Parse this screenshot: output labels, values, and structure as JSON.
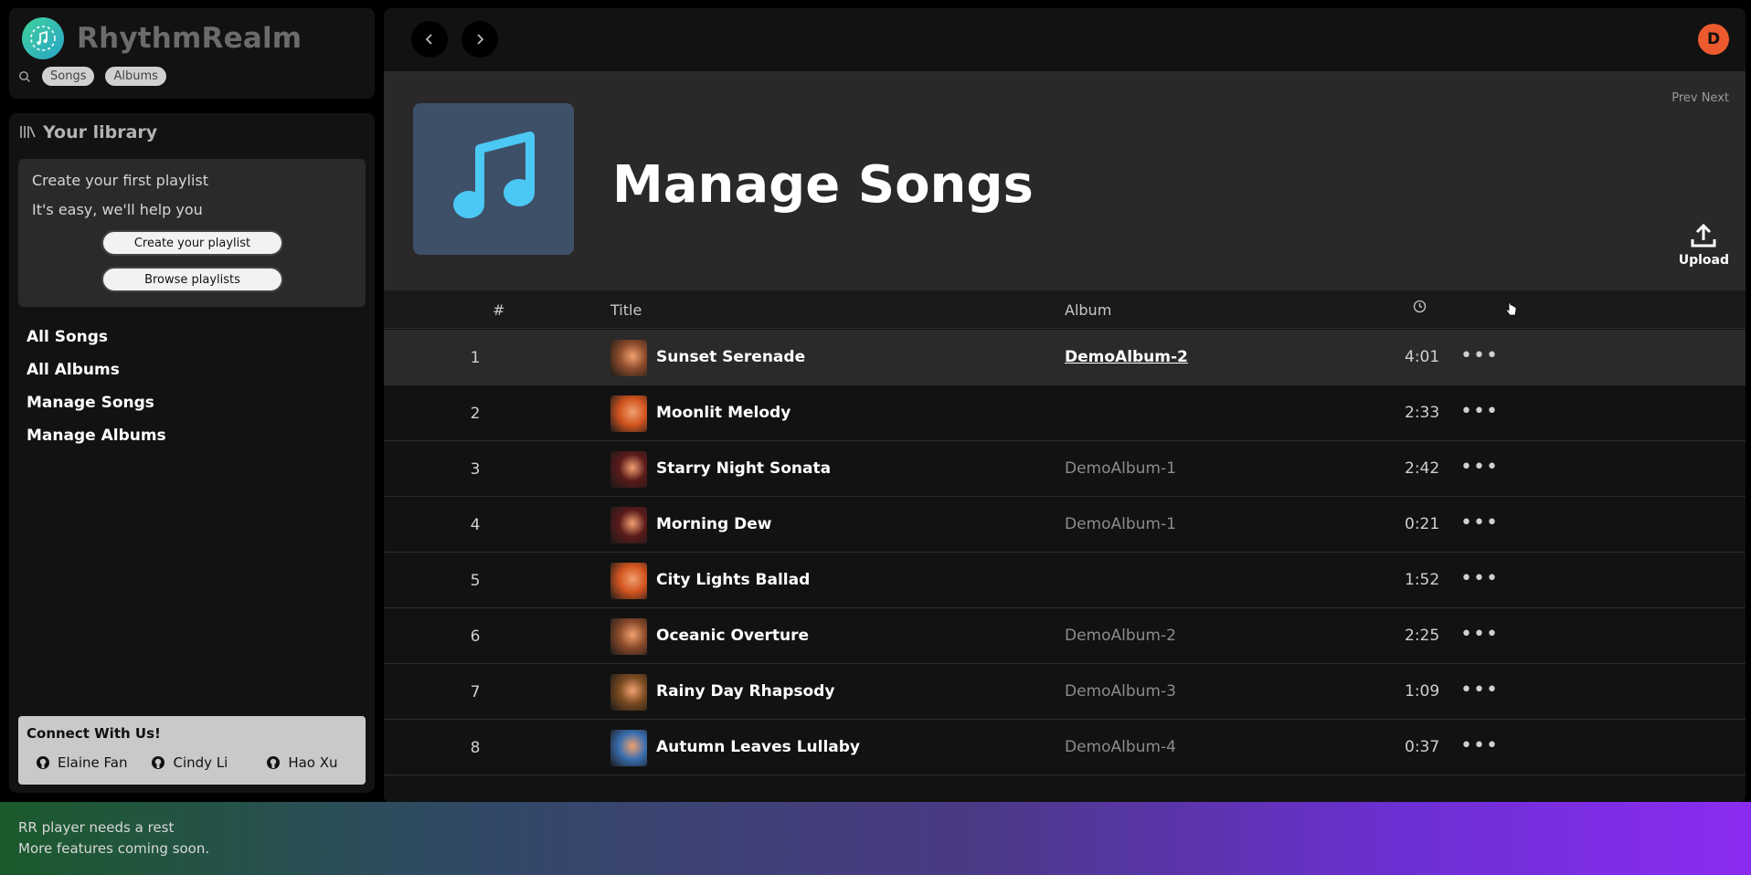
{
  "app": {
    "name": "RhythmRealm"
  },
  "sidebar": {
    "search_pills": [
      "Songs",
      "Albums"
    ],
    "library_title": "Your library",
    "playlist_box": {
      "line1": "Create your first playlist",
      "line2": "It's easy, we'll help you",
      "create_btn": "Create your playlist",
      "browse_btn": "Browse playlists"
    },
    "nav": [
      "All Songs",
      "All Albums",
      "Manage Songs",
      "Manage Albums"
    ],
    "connect": {
      "title": "Connect With Us!",
      "people": [
        "Elaine Fan",
        "Cindy Li",
        "Hao Xu"
      ]
    }
  },
  "header": {
    "avatar_letter": "D"
  },
  "hero": {
    "title": "Manage Songs",
    "pager": "Prev Next",
    "upload_label": "Upload"
  },
  "table": {
    "columns": {
      "num": "#",
      "title": "Title",
      "album": "Album"
    },
    "rows": [
      {
        "num": "1",
        "title": "Sunset Serenade",
        "album": "DemoAlbum-2",
        "duration": "4:01",
        "thumb": "#8a4a2a",
        "hover": true
      },
      {
        "num": "2",
        "title": "Moonlit Melody",
        "album": "",
        "duration": "2:33",
        "thumb": "#d2541e",
        "hover": false
      },
      {
        "num": "3",
        "title": "Starry Night Sonata",
        "album": "DemoAlbum-1",
        "duration": "2:42",
        "thumb": "#5a1a1a",
        "hover": false
      },
      {
        "num": "4",
        "title": "Morning Dew",
        "album": "DemoAlbum-1",
        "duration": "0:21",
        "thumb": "#5a1a1a",
        "hover": false
      },
      {
        "num": "5",
        "title": "City Lights Ballad",
        "album": "",
        "duration": "1:52",
        "thumb": "#d2541e",
        "hover": false
      },
      {
        "num": "6",
        "title": "Oceanic Overture",
        "album": "DemoAlbum-2",
        "duration": "2:25",
        "thumb": "#8a4a2a",
        "hover": false
      },
      {
        "num": "7",
        "title": "Rainy Day Rhapsody",
        "album": "DemoAlbum-3",
        "duration": "1:09",
        "thumb": "#7a4a20",
        "hover": false
      },
      {
        "num": "8",
        "title": "Autumn Leaves Lullaby",
        "album": "DemoAlbum-4",
        "duration": "0:37",
        "thumb": "#3a6fb0",
        "hover": false
      }
    ]
  },
  "player": {
    "line1": "RR player needs a rest",
    "line2": "More features coming soon."
  },
  "colors": {
    "accent_avatar": "#ec5a2e",
    "cover_bg": "#3d5068",
    "note_color": "#4cc8f4"
  }
}
